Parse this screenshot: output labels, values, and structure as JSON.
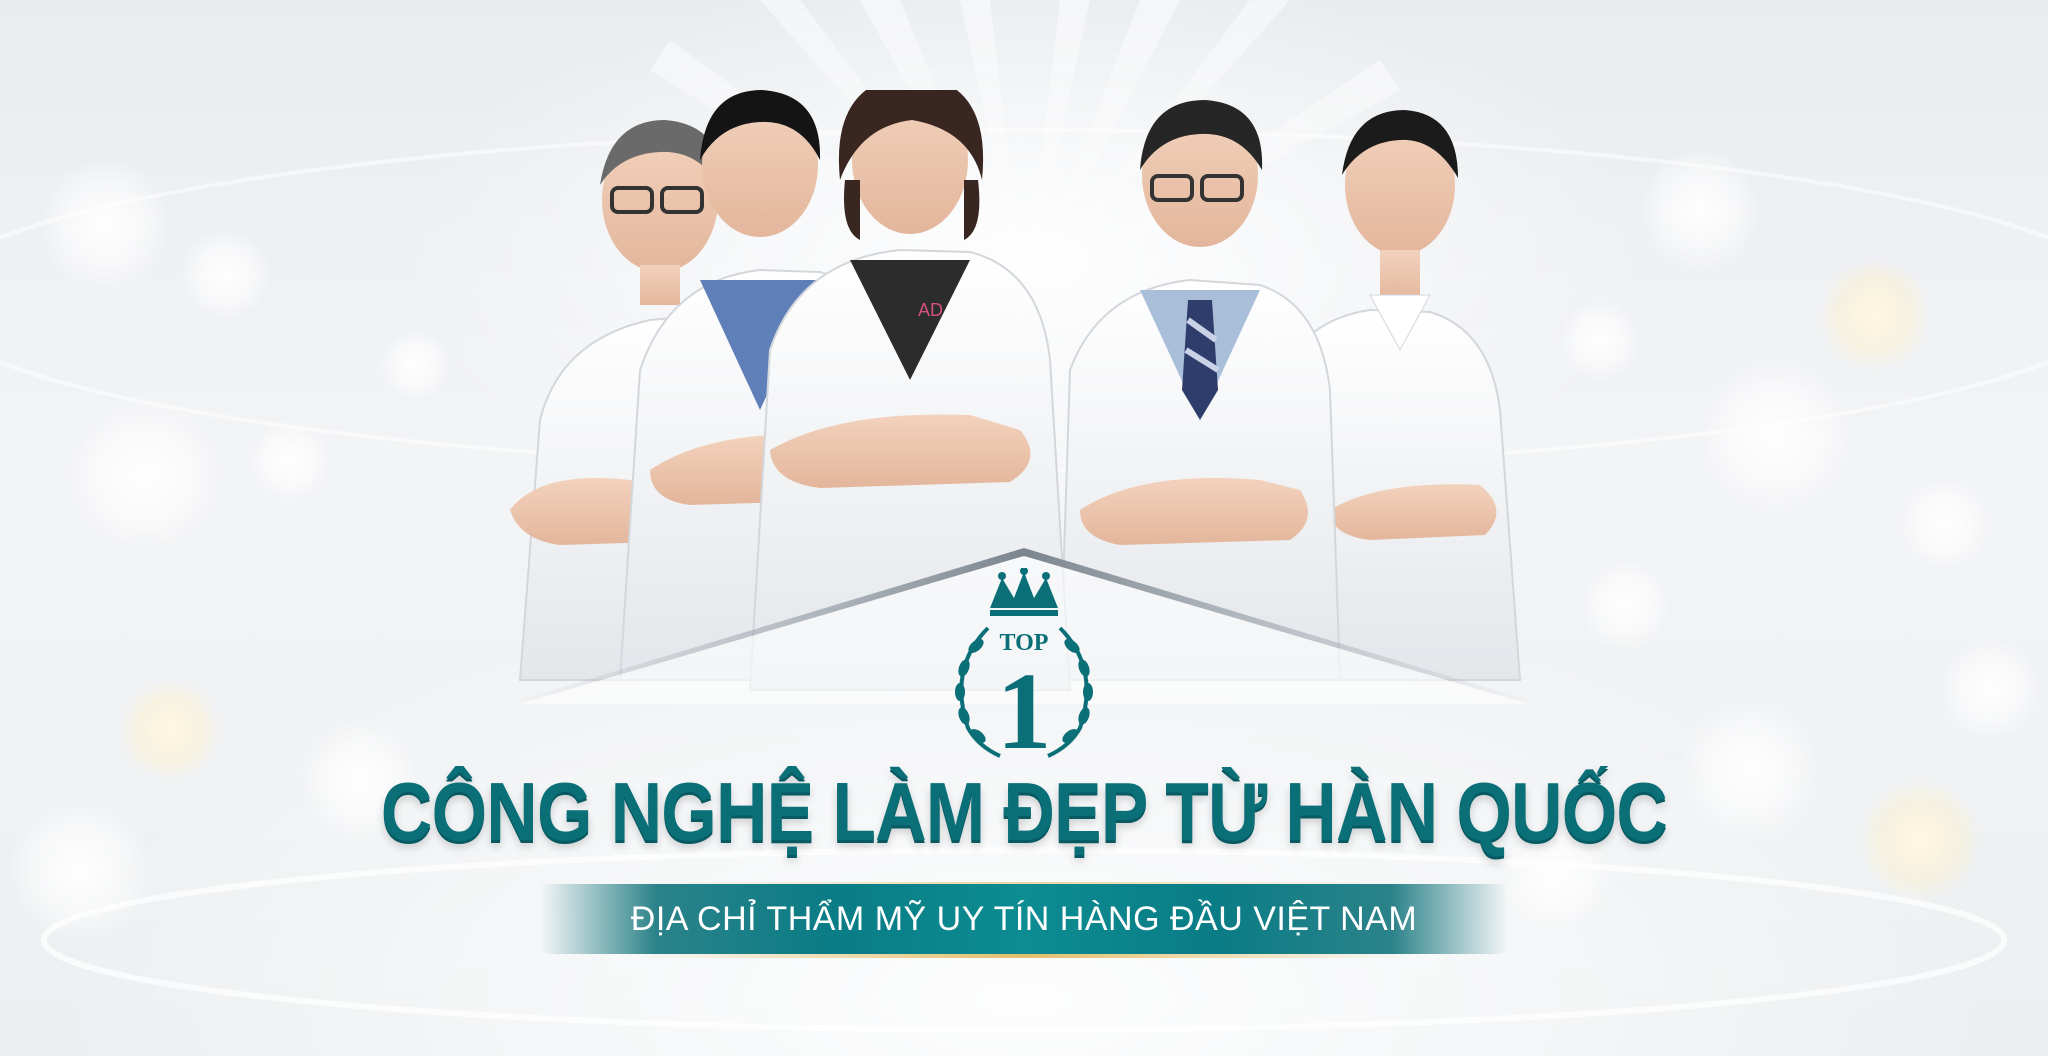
{
  "banner": {
    "headline": "CÔNG NGHỆ LÀM ĐẸP TỪ HÀN QUỐC",
    "subheadline": "ĐỊA CHỈ THẨM MỸ UY TÍN HÀNG ĐẦU VIỆT NAM",
    "emblem": {
      "top_label": "TOP",
      "rank": "1",
      "icon": "crown-laurel-icon"
    },
    "coat_logo_text": "AD"
  },
  "colors": {
    "brand_teal": "#0b6f78",
    "ribbon_teal": "#0a7c85",
    "gold": "#e2bf6d",
    "background": "#eef0f2"
  }
}
